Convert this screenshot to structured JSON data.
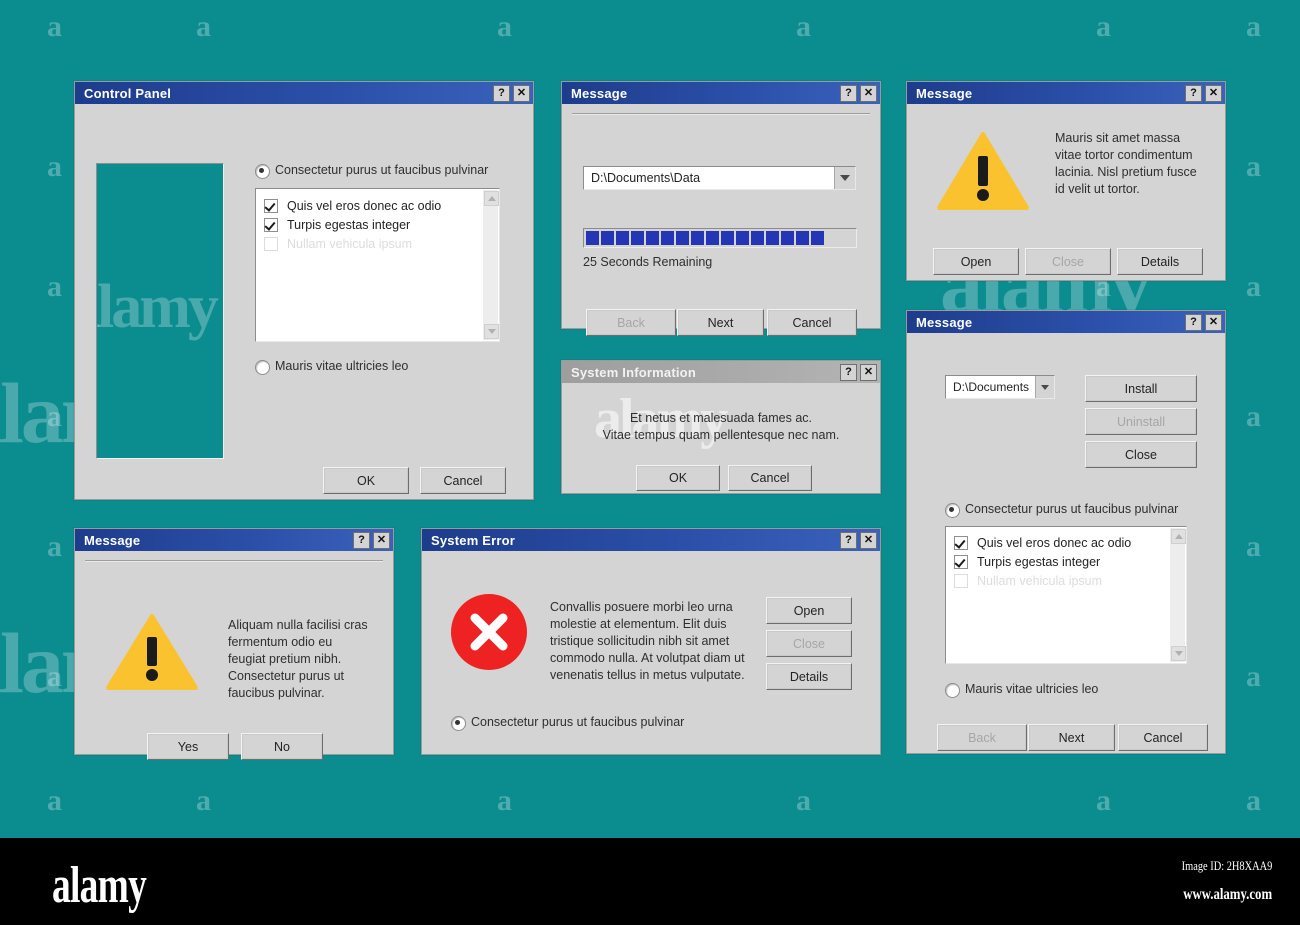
{
  "background": {
    "color": "#0b8c8f",
    "watermark_letter": "a",
    "watermark_word": "alamy"
  },
  "windows": {
    "control_panel": {
      "title": "Control Panel",
      "help_btn": "?",
      "close_btn": "✕",
      "radio_top": {
        "label": "Consectetur purus ut faucibus pulvinar",
        "selected": true
      },
      "radio_bottom": {
        "label": "Mauris vitae ultricies leo",
        "selected": false
      },
      "list_items": [
        {
          "label": "Quis vel eros donec ac odio",
          "checked": true,
          "dim": false
        },
        {
          "label": "Turpis egestas integer",
          "checked": true,
          "dim": false
        },
        {
          "label": "Nullam vehicula ipsum",
          "checked": false,
          "dim": true
        }
      ],
      "ok_label": "OK",
      "cancel_label": "Cancel"
    },
    "progress_message": {
      "title": "Message",
      "help_btn": "?",
      "close_btn": "✕",
      "path_value": "D:\\Documents\\Data",
      "progress_blocks": 16,
      "progress_total": 20,
      "progress_percent": 80,
      "status_text": "25 Seconds Remaining",
      "buttons": [
        {
          "label": "Back",
          "disabled": true
        },
        {
          "label": "Next",
          "disabled": false
        },
        {
          "label": "Cancel",
          "disabled": false
        }
      ]
    },
    "system_information": {
      "title": "System Information",
      "help_btn": "?",
      "close_btn": "✕",
      "active": false,
      "body_line1": "Et netus et malesuada fames ac.",
      "body_line2": "Vitae tempus quam pellentesque nec nam.",
      "ok_label": "OK",
      "cancel_label": "Cancel"
    },
    "warning_message": {
      "title": "Message",
      "help_btn": "?",
      "close_btn": "✕",
      "icon": "warning-triangle-icon",
      "body": "Mauris sit amet massa vitae tortor condimentum lacinia. Nisl pretium fusce id velit ut tortor.",
      "buttons": [
        {
          "label": "Open",
          "disabled": false
        },
        {
          "label": "Close",
          "disabled": true
        },
        {
          "label": "Details",
          "disabled": false
        }
      ]
    },
    "installer_message": {
      "title": "Message",
      "help_btn": "?",
      "close_btn": "✕",
      "path_value": "D:\\Documents",
      "buttons_right": [
        {
          "label": "Install",
          "disabled": false
        },
        {
          "label": "Uninstall",
          "disabled": true
        },
        {
          "label": "Close",
          "disabled": false
        }
      ],
      "radio_top": {
        "label": "Consectetur purus ut faucibus pulvinar",
        "selected": true
      },
      "radio_bottom": {
        "label": "Mauris vitae ultricies leo",
        "selected": false
      },
      "list_items": [
        {
          "label": "Quis vel eros donec ac odio",
          "checked": true,
          "dim": false
        },
        {
          "label": "Turpis egestas integer",
          "checked": true,
          "dim": false
        },
        {
          "label": "Nullam vehicula ipsum",
          "checked": false,
          "dim": true
        }
      ],
      "buttons_bottom": [
        {
          "label": "Back",
          "disabled": true
        },
        {
          "label": "Next",
          "disabled": false
        },
        {
          "label": "Cancel",
          "disabled": false
        }
      ]
    },
    "yes_no_message": {
      "title": "Message",
      "help_btn": "?",
      "close_btn": "✕",
      "icon": "warning-triangle-icon",
      "body": "Aliquam nulla facilisi cras fermentum odio eu feugiat pretium nibh. Consectetur purus ut faucibus pulvinar.",
      "yes_label": "Yes",
      "no_label": "No"
    },
    "system_error": {
      "title": "System Error",
      "help_btn": "?",
      "close_btn": "✕",
      "icon": "error-circle-icon",
      "body": "Convallis posuere morbi leo urna molestie at elementum. Elit duis tristique sollicitudin nibh sit amet commodo nulla. At volutpat diam ut venenatis tellus in metus vulputate.",
      "buttons": [
        {
          "label": "Open",
          "disabled": false
        },
        {
          "label": "Close",
          "disabled": true
        },
        {
          "label": "Details",
          "disabled": false
        }
      ],
      "radio": {
        "label": "Consectetur purus ut faucibus pulvinar",
        "selected": true
      }
    }
  },
  "footer": {
    "logo": "alamy",
    "image_id": "Image ID: 2H8XAA9",
    "url": "www.alamy.com"
  },
  "colors": {
    "teal": "#0b8c8f",
    "titlebar_active": "#1e3c8c",
    "titlebar_inactive": "#a0a0a0",
    "dialog_face": "#d4d4d4",
    "progress_fill": "#2436b6",
    "warning_yellow": "#f9c22e",
    "error_red": "#ee2222"
  }
}
